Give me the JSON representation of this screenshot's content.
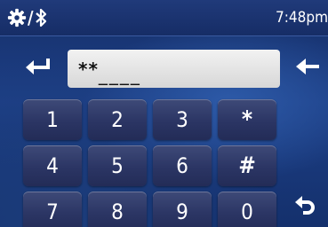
{
  "status_bar": {
    "time": "7:48pm",
    "icons": [
      "settings-gear-icon",
      "bluetooth-icon"
    ],
    "separator": "/"
  },
  "entry": {
    "masked": "**",
    "placeholder": "____"
  },
  "keypad": {
    "keys": [
      "1",
      "2",
      "3",
      "*",
      "4",
      "5",
      "6",
      "#",
      "7",
      "8",
      "9",
      "0"
    ]
  },
  "icons": {
    "left_action": "return-arrow-icon",
    "right_action": "back-arrow-icon",
    "bottom_right": "undo-arrow-icon"
  },
  "colors": {
    "background": "#1d3f86",
    "key": "#2b3564",
    "field": "#e6e6e6",
    "text": "#ffffff"
  }
}
